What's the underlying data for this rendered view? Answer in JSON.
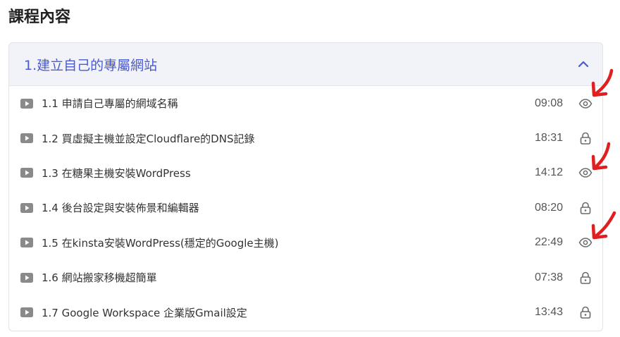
{
  "page": {
    "title": "課程內容"
  },
  "section": {
    "title": "1.建立自己的專屬網站",
    "expanded": true
  },
  "lessons": [
    {
      "title": "1.1 申請自己專屬的網域名稱",
      "duration": "09:08",
      "access": "preview"
    },
    {
      "title": "1.2 買虛擬主機並設定Cloudflare的DNS記錄",
      "duration": "18:31",
      "access": "locked"
    },
    {
      "title": "1.3 在糖果主機安裝WordPress",
      "duration": "14:12",
      "access": "preview"
    },
    {
      "title": "1.4 後台設定與安裝佈景和編輯器",
      "duration": "08:20",
      "access": "locked"
    },
    {
      "title": "1.5 在kinsta安裝WordPress(穩定的Google主機)",
      "duration": "22:49",
      "access": "preview"
    },
    {
      "title": "1.6 網站搬家移機超簡單",
      "duration": "07:38",
      "access": "locked"
    },
    {
      "title": "1.7 Google Workspace 企業版Gmail設定",
      "duration": "13:43",
      "access": "locked"
    }
  ],
  "colors": {
    "accent": "#4a5ad0",
    "header_bg": "#f2f3f8",
    "icon_gray": "#8a8a8a",
    "annotation_red": "#e02020"
  },
  "icons": {
    "play": "play-video-icon",
    "preview": "eye-icon",
    "locked": "lock-icon",
    "collapse": "chevron-up-icon"
  }
}
